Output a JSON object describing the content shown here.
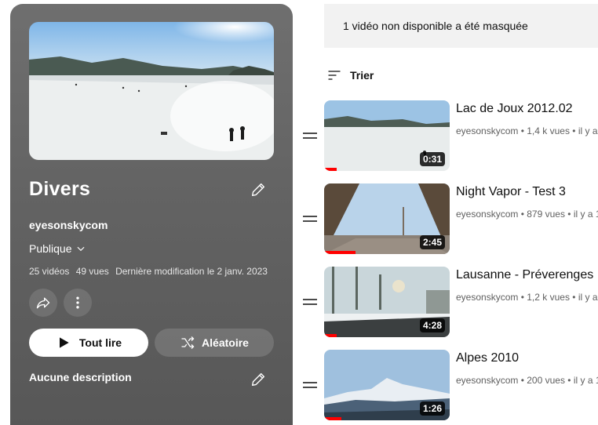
{
  "playlist": {
    "title": "Divers",
    "owner": "eyesonskycom",
    "privacy": "Publique",
    "video_count": "25 vidéos",
    "views": "49 vues",
    "last_modified": "Dernière modification le 2 janv. 2023",
    "play_all_label": "Tout lire",
    "shuffle_label": "Aléatoire",
    "description": "Aucune description"
  },
  "notice": "1 vidéo non disponible a été masquée",
  "sort_label": "Trier",
  "videos": [
    {
      "title": "Lac de Joux 2012.02",
      "channel": "eyesonskycom",
      "meta": "1,4 k vues • il y a",
      "duration": "0:31",
      "watched": 0.1
    },
    {
      "title": "Night Vapor - Test 3",
      "channel": "eyesonskycom",
      "meta": "879 vues • il y a 1",
      "duration": "2:45",
      "watched": 0.25
    },
    {
      "title": "Lausanne - Préverenges",
      "channel": "eyesonskycom",
      "meta": "1,2 k vues • il y a",
      "duration": "4:28",
      "watched": 0.1
    },
    {
      "title": "Alpes 2010",
      "channel": "eyesonskycom",
      "meta": "200 vues • il y a 1",
      "duration": "1:26",
      "watched": 0.14
    }
  ],
  "colors": {
    "progress": "#ff0000",
    "panel": "#636363",
    "notice_bg": "#f2f2f2"
  },
  "icons": [
    "pencil-icon",
    "chevron-down-icon",
    "share-icon",
    "more-vert-icon",
    "play-icon",
    "shuffle-icon",
    "sort-icon",
    "drag-handle-icon"
  ]
}
